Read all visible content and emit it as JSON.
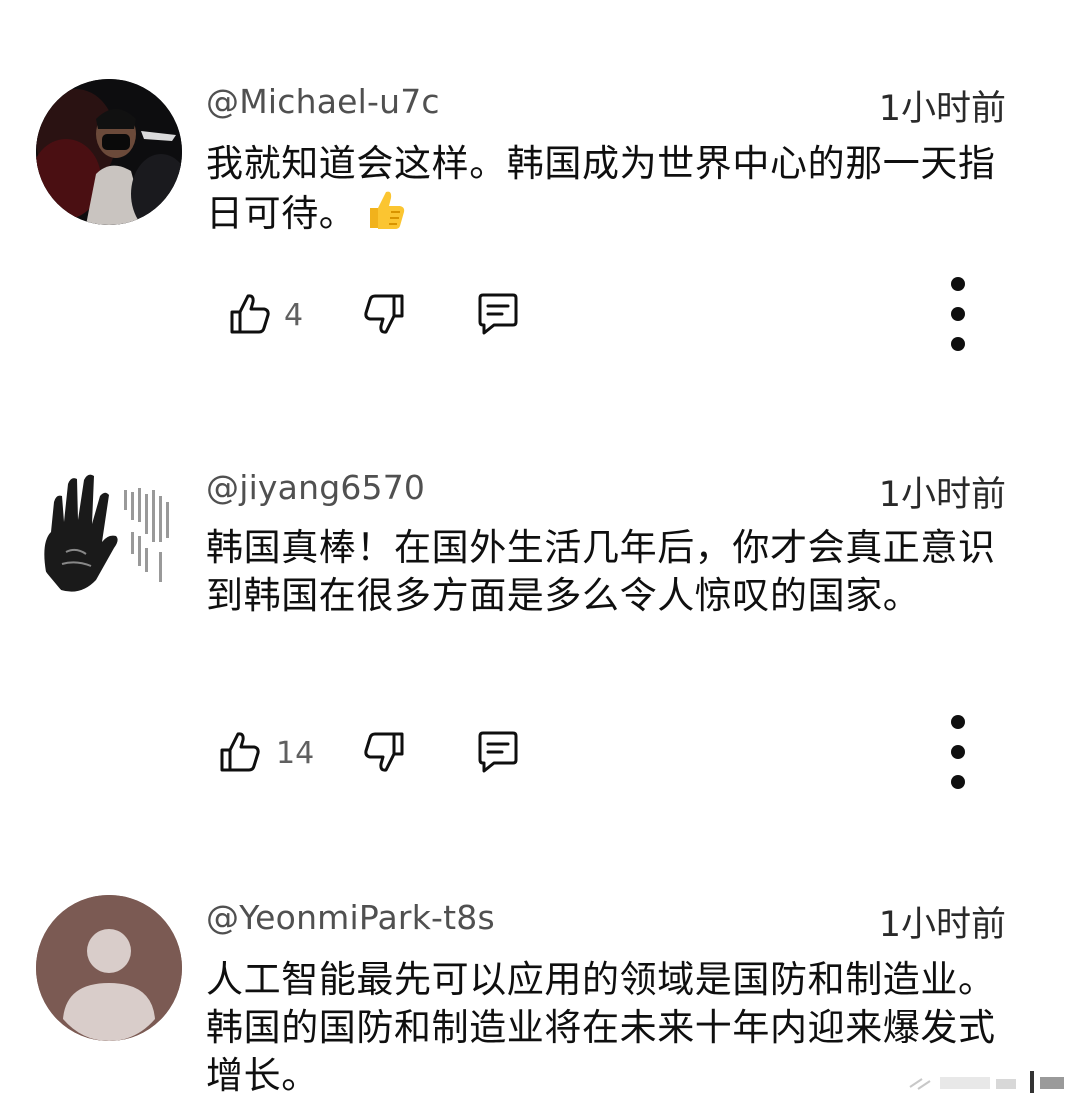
{
  "comments": [
    {
      "handle": "@Michael-u7c",
      "time": "1小时前",
      "text": "我就知道会这样。韩国成为世界中心的那一天指日可待。",
      "emoji": "thumbs-up-emoji",
      "likes": "4",
      "avatar": "photo-avatar-dark"
    },
    {
      "handle": "@jiyang6570",
      "time": "1小时前",
      "text": "韩国真棒！在国外生活几年后，你才会真正意识到韩国在很多方面是多么令人惊叹的国家。",
      "likes": "14",
      "avatar": "handprint-avatar"
    },
    {
      "handle": "@YeonmiPark-t8s",
      "time": "1小时前",
      "text": "人工智能最先可以应用的领域是国防和制造业。韩国的国防和制造业将在未来十年内迎来爆发式增长。",
      "avatar": "default-avatar"
    }
  ],
  "colors": {
    "default_avatar_bg": "#7b5a53",
    "default_avatar_fg": "#d9cdca",
    "icon": "#0f0f0f",
    "muted": "#606060"
  }
}
